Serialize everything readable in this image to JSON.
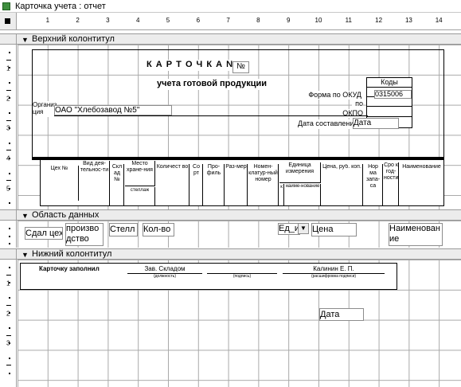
{
  "window": {
    "title": "Карточка учета : отчет",
    "icon": "report-icon"
  },
  "ruler": {
    "horizontal": [
      "1",
      "2",
      "3",
      "4",
      "5",
      "6",
      "7",
      "8",
      "9",
      "10",
      "11",
      "12",
      "13",
      "14",
      "1"
    ],
    "vertical_header": [
      "1",
      "2",
      "3",
      "4",
      "5"
    ],
    "vertical_footer": [
      "1",
      "2",
      "3"
    ]
  },
  "sections": {
    "header": "Верхний колонтитул",
    "detail": "Область данных",
    "footer": "Нижний колонтитул"
  },
  "header": {
    "title": "К А Р Т О Ч К А №",
    "number_field": "№",
    "subtitle": "учета готовой продукции",
    "codes_label": "Коды",
    "okud_label": "Форма по ОКУД",
    "okud_value": "0315006",
    "po_label": "по",
    "okpo_label": "ОКПО",
    "date_label": "Дата составлени",
    "date_field": "Дата",
    "org_label": "Организа ция",
    "org_value": "ОАО \"Хлебозавод №5\""
  },
  "table_header": {
    "columns": [
      "Цех №",
      "Вид дея-тельнос-ти",
      "Скл ад №",
      "Место хране-ния",
      "Количест во",
      "Со рт",
      "Про-филь",
      "Раз-мер",
      "Номен-клатур-ный номер",
      "Единица измерения",
      "Цена, руб. коп.",
      "Нор ма запа-са",
      "Сро к год-ности",
      "Наименование"
    ],
    "sub_storage": "стеллаж",
    "sub_unit": "наиме-нование",
    "sub_unit_code": "к"
  },
  "detail_fields": {
    "shop": "Сдал цех",
    "activity": "произво дство",
    "shelf": "Стелл",
    "qty": "Кол-во",
    "unit": "Ед_и",
    "price": "Цена",
    "name": "Наименован ие"
  },
  "footer": {
    "filled_label": "Карточку заполнил",
    "position_value": "Зав. Складом",
    "position_caption": "(должность)",
    "signature_caption": "(подпись)",
    "name_value": "Калинин Е. П.",
    "name_caption": "(расшифровка подписи)",
    "date_field": "Дата"
  }
}
